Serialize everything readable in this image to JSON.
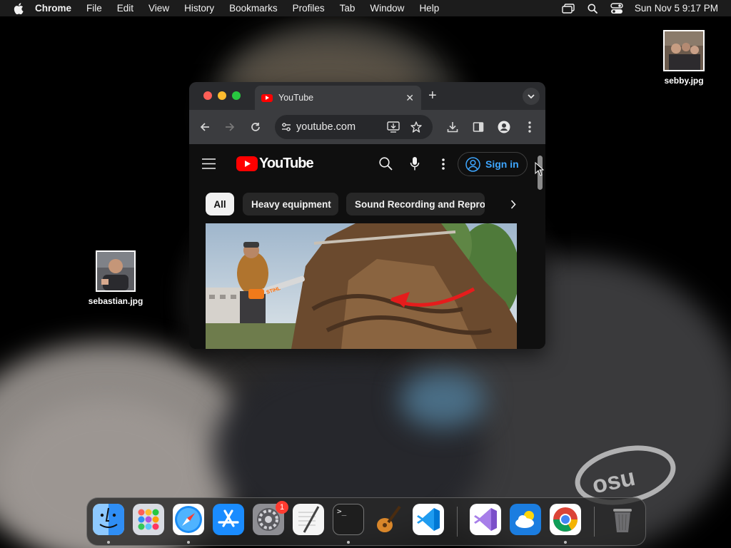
{
  "menubar": {
    "app_name": "Chrome",
    "items": [
      "File",
      "Edit",
      "View",
      "History",
      "Bookmarks",
      "Profiles",
      "Tab",
      "Window",
      "Help"
    ],
    "clock": "Sun Nov 5  9:17 PM"
  },
  "desktop": {
    "files": [
      {
        "name": "sebby.jpg",
        "icon": "photo-thumbnail"
      },
      {
        "name": "sebastian.jpg",
        "icon": "photo-thumbnail"
      }
    ]
  },
  "browser": {
    "tab_title": "YouTube",
    "url": "youtube.com",
    "new_tab_symbol": "+",
    "close_symbol": "✕"
  },
  "youtube": {
    "logo_text": "YouTube",
    "sign_in_label": "Sign in",
    "chips": [
      "All",
      "Heavy equipment",
      "Sound Recording and Reprod"
    ],
    "active_chip": "All",
    "thumbnail_watermark": "STIHL"
  },
  "dock": {
    "apps": [
      "Finder",
      "Launchpad",
      "Safari",
      "App Store",
      "System Settings",
      "TextEdit",
      "Terminal",
      "GarageBand",
      "Visual Studio Code",
      "Visual Studio",
      "Weather",
      "Google Chrome",
      "Trash"
    ],
    "settings_badge": "1",
    "terminal_prompt": ">_"
  },
  "colors": {
    "menubar_bg": "#1c1c1c",
    "youtube_red": "#ff0000",
    "sign_in_blue": "#3ea6ff",
    "badge_red": "#ff3b30"
  }
}
